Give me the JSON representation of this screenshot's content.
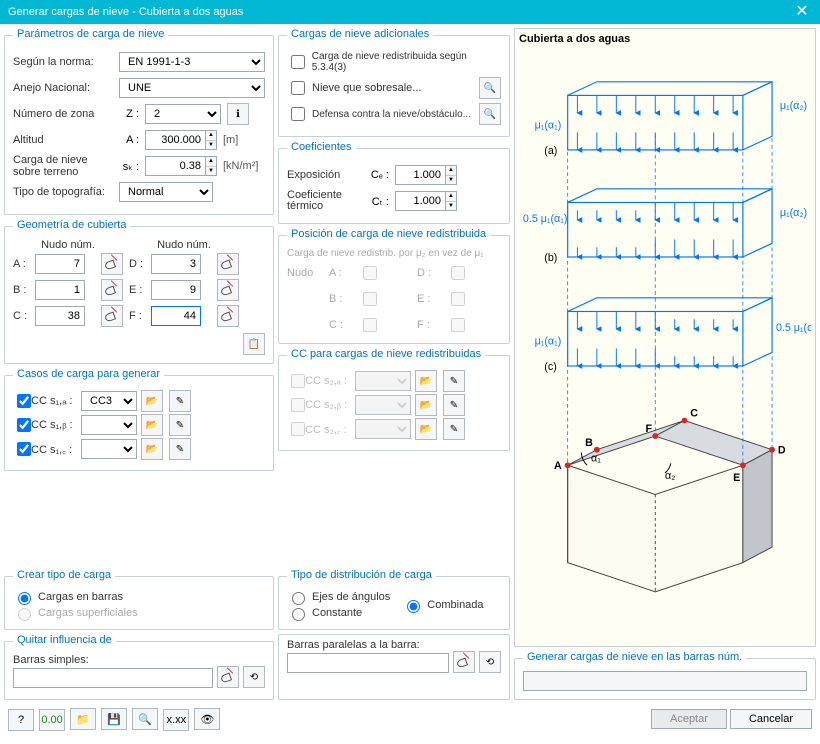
{
  "title": "Generar cargas de nieve - Cubierta a dos aguas",
  "params": {
    "legend": "Parámetros de carga de nieve",
    "norm_lbl": "Según la norma:",
    "norm_val": "EN 1991-1-3",
    "annex_lbl": "Anejo Nacional:",
    "annex_val": "UNE",
    "zone_lbl": "Número de zona",
    "zone_sym": "Z :",
    "zone_val": "2",
    "alt_lbl": "Altitud",
    "alt_sym": "A :",
    "alt_val": "300.000",
    "alt_unit": "[m]",
    "terrain_lbl": "Carga de nieve sobre terreno",
    "terrain_sym": "sₖ :",
    "terrain_val": "0.38",
    "terrain_unit": "[kN/m²]",
    "topo_lbl": "Tipo de topografía:",
    "topo_val": "Normal"
  },
  "addl": {
    "legend": "Cargas de nieve adicionales",
    "redist": "Carga de nieve redistribuida según 5.3.4(3)",
    "overhang": "Nieve que sobresale...",
    "guard": "Defensa contra la nieve/obstáculo..."
  },
  "coef": {
    "legend": "Coeficientes",
    "exp_lbl": "Exposición",
    "exp_sym": "Cₑ :",
    "exp_val": "1.000",
    "th_lbl": "Coeficiente térmico",
    "th_sym": "Cₜ :",
    "th_val": "1.000"
  },
  "geom": {
    "legend": "Geometría de cubierta",
    "hdr": "Nudo núm.",
    "A": "A :",
    "Av": "7",
    "B": "B :",
    "Bv": "1",
    "C": "C :",
    "Cv": "38",
    "D": "D :",
    "Dv": "3",
    "E": "E :",
    "Ev": "9",
    "F": "F :",
    "Fv": "44"
  },
  "pos": {
    "legend": "Posición de carga de nieve redistribuida",
    "sub": "Carga de nieve redistrib. por μ₂ en vez de μ₁",
    "node": "Nudo",
    "A": "A :",
    "B": "B :",
    "C": "C :",
    "D": "D :",
    "E": "E :",
    "F": "F :"
  },
  "cc": {
    "legend": "Casos de carga para generar",
    "a": "CC s₁,ₐ :",
    "av": "CC3",
    "b": "CC s₁,ᵦ :",
    "bv": "",
    "c": "CC s₁,꜀ :",
    "cv": ""
  },
  "cc2": {
    "legend": "CC para cargas de nieve redistribuidas",
    "a": "CC s₂,ₐ :",
    "b": "CC s₂,ᵦ :",
    "c": "CC s₂,꜀ :"
  },
  "ctype": {
    "legend": "Crear tipo de carga",
    "bars": "Cargas en barras",
    "surf": "Cargas superficiales"
  },
  "dist": {
    "legend": "Tipo de distribución de carga",
    "axes": "Ejes de ángulos",
    "const": "Constante",
    "comb": "Combinada"
  },
  "remove": {
    "legend": "Quitar influencia de",
    "simple": "Barras simples:",
    "parallel": "Barras paralelas a la barra:"
  },
  "diag": {
    "title": "Cubierta a dos aguas",
    "legend": "Generar cargas de nieve en las barras núm."
  },
  "buttons": {
    "ok": "Aceptar",
    "cancel": "Cancelar"
  }
}
